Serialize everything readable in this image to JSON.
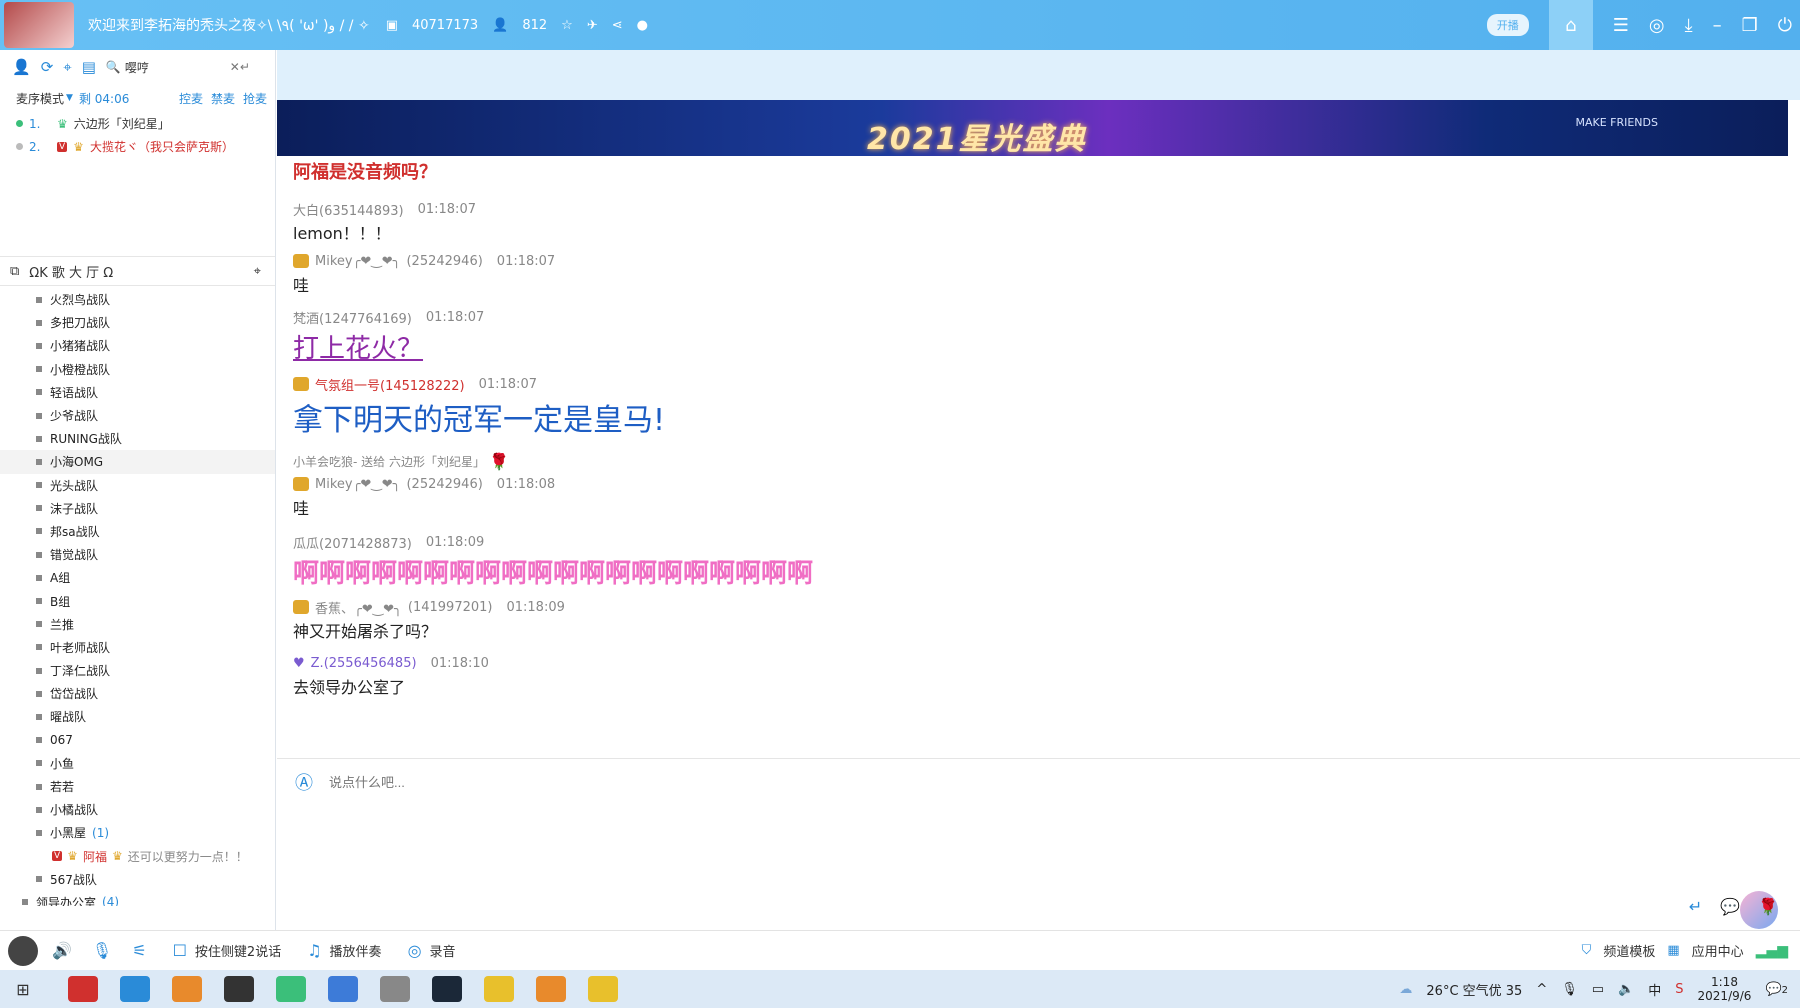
{
  "titlebar": {
    "title": "欢迎来到李拓海的秃头之夜✧\\ \\٩( 'ω' )و / / ✧",
    "room_id": "40717173",
    "online": "812",
    "pill": "开播"
  },
  "left": {
    "search_value": "嘤哼",
    "queue_mode": "麦序模式",
    "queue_remaining": "剩 04:06",
    "queue_links": [
      "控麦",
      "禁麦",
      "抢麦"
    ],
    "queue": [
      {
        "num": "1.",
        "name": "六边形「刘纪星」"
      },
      {
        "num": "2.",
        "name": "大揽花ヾ（我只会萨克斯）"
      }
    ],
    "toolbar_text": "ΩK 歌 大 厅 Ω",
    "channels": [
      "火烈鸟战队",
      "多把刀战队",
      "小猪猪战队",
      "小橙橙战队",
      "轻语战队",
      "少爷战队",
      "RUNING战队",
      "小海OMG",
      "光头战队",
      "沫子战队",
      "邦sa战队",
      "错觉战队",
      "A组",
      "B组",
      "兰推",
      "叶老师战队",
      "丁泽仁战队",
      "岱岱战队",
      "曜战队",
      "067",
      "小鱼",
      "若若",
      "小橘战队",
      "小黑屋"
    ],
    "small_room_count": "(1)",
    "room_user": {
      "name": "阿福",
      "signature": "还可以更努力一点！！"
    },
    "after_channels": [
      "567战队"
    ],
    "leader_room": "领导办公室",
    "leader_count": "(4)"
  },
  "banner": {
    "text": "2021星光盛典",
    "make": "MAKE FRIENDS"
  },
  "chat": {
    "m0_text": "阿福是没音频吗？",
    "m1": {
      "name": "大白(635144893)",
      "time": "01:18:07",
      "text": "lemon！！！"
    },
    "m2": {
      "name": "Mikey╭❤‿❤╮",
      "id": "(25242946)",
      "time": "01:18:07",
      "text": "哇"
    },
    "m3": {
      "name": "梵酒(1247764169)",
      "time": "01:18:07",
      "text": "打上花火？"
    },
    "m4": {
      "name": "气氛组一号(145128222)",
      "time": "01:18:07",
      "text": "拿下明天的冠军一定是皇马!"
    },
    "gift": "小羊会吃狼- 送给 六边形「刘纪星」",
    "m5": {
      "name": "Mikey╭❤‿❤╮",
      "id": "(25242946)",
      "time": "01:18:08",
      "text": "哇"
    },
    "m6": {
      "name": "瓜瓜(2071428873)",
      "time": "01:18:09",
      "text": "啊啊啊啊啊啊啊啊啊啊啊啊啊啊啊啊啊啊啊啊"
    },
    "m7": {
      "name": "香蕉、╭❤‿❤╮",
      "id": "(141997201)",
      "time": "01:18:09",
      "text": "神又开始屠杀了吗？"
    },
    "m8": {
      "name": "Z.(2556456485)",
      "time": "01:18:10",
      "text": "去领导办公室了"
    },
    "input_placeholder": "说点什么吧..."
  },
  "status": {
    "push_talk": "按住侧键2说话",
    "play_music": "播放伴奏",
    "record": "录音",
    "channel_template": "频道模板",
    "app_center": "应用中心"
  },
  "taskbar": {
    "weather": "26°C 空气优 35",
    "ime": "中",
    "time": "1:18",
    "date": "2021/9/6",
    "notif": "2"
  }
}
